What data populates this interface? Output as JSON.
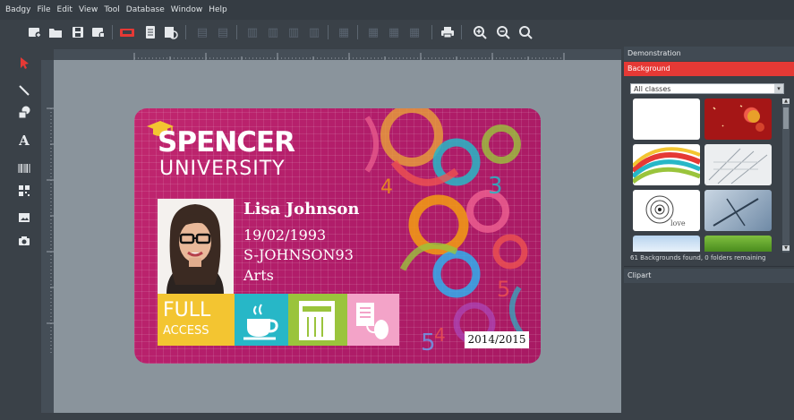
{
  "menu": [
    "Badgy",
    "File",
    "Edit",
    "View",
    "Tool",
    "Database",
    "Window",
    "Help"
  ],
  "card": {
    "uni_line1": "SPENCER",
    "uni_line2": "UNIVERSITY",
    "name": "Lisa Johnson",
    "dob": "19/02/1993",
    "username": "S-JOHNSON93",
    "faculty": "Arts",
    "access1": "FULL",
    "access2": "ACCESS",
    "year": "2014/2015"
  },
  "panel": {
    "demo_title": "Demonstration",
    "background_title": "Background",
    "filter_value": "All classes",
    "status": "61 Backgrounds found, 0 folders remaining",
    "clipart_title": "Clipart"
  },
  "colors": {
    "accent_red": "#e53935",
    "card_magenta": "#b51f69",
    "card_yellow": "#f3c531",
    "card_cyan": "#27b7c7",
    "card_green": "#9ac43c",
    "card_pink": "#f3a3c8"
  },
  "icons": {
    "toolbar": [
      "new-card-icon",
      "open-folder-icon",
      "save-icon",
      "save-as-icon",
      "print-card-icon",
      "single-card-icon",
      "database-icon",
      "align-icon",
      "print-icon",
      "zoom-in-icon",
      "zoom-out-icon",
      "zoom-fit-icon"
    ],
    "tools": [
      "select-arrow-icon",
      "line-icon",
      "shapes-icon",
      "text-icon",
      "barcode-icon",
      "qr-code-icon",
      "image-icon",
      "camera-icon"
    ]
  }
}
